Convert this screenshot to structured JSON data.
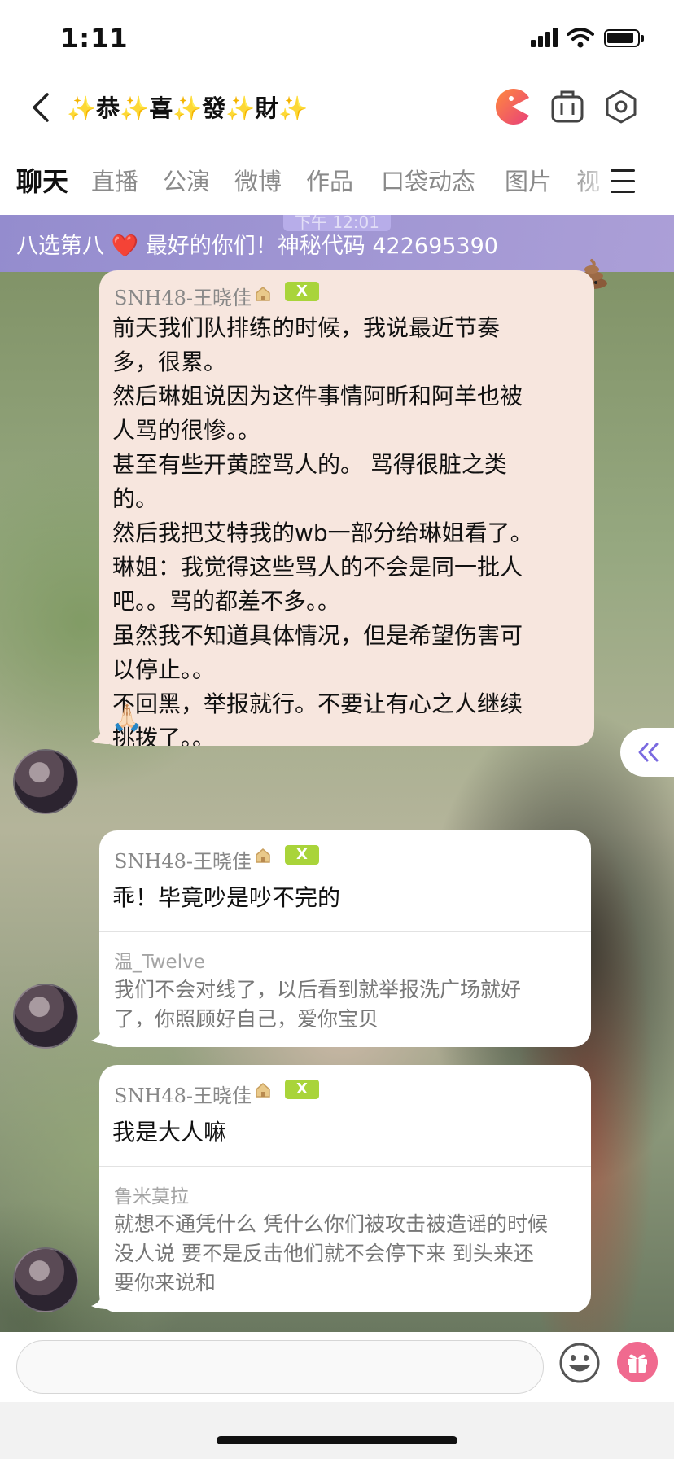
{
  "status_bar": {
    "time": "1:11"
  },
  "header": {
    "title": "✨恭✨喜✨發✨財✨"
  },
  "tabs": [
    "聊天",
    "直播",
    "公演",
    "微博",
    "作品",
    "口袋动态",
    "图片",
    "视"
  ],
  "banner": {
    "text": "八选第八 ❤️ 最好的你们！神秘代码 422695390",
    "ghost_time": "下午 12:01"
  },
  "messages": [
    {
      "sender": "SNH48-王晓佳",
      "badge": "X",
      "lines": [
        "前天我们队排练的时候，我说最近节奏",
        "多，很累。",
        "然后琳姐说因为这件事情阿昕和阿羊也被",
        "人骂的很惨。。",
        "甚至有些开黄腔骂人的。 骂得很脏之类",
        "的。",
        "然后我把艾特我的wb一部分给琳姐看了。",
        "琳姐：我觉得这些骂人的不会是同一批人",
        "吧。。骂的都差不多。。",
        "虽然我不知道具体情况，但是希望伤害可",
        "以停止。。",
        "不回黑，举报就行。不要让有心之人继续",
        "挑拨了。。"
      ],
      "emoji": "🙏🏻"
    },
    {
      "sender": "SNH48-王晓佳",
      "badge": "X",
      "text": "乖！毕竟吵是吵不完的",
      "quote_user": "温_Twelve",
      "quote_lines": [
        "我们不会对线了，以后看到就举报洗广场就好",
        "了，你照顾好自己，爱你宝贝"
      ]
    },
    {
      "sender": "SNH48-王晓佳",
      "badge": "X",
      "text": "我是大人嘛",
      "quote_user": "鲁米莫拉",
      "quote_lines": [
        "就想不通凭什么 凭什么你们被攻击被造谣的时候",
        "没人说  要不是反击他们就不会停下来  到头来还",
        "要你来说和"
      ]
    }
  ],
  "input": {
    "placeholder": ""
  },
  "colors": {
    "banner": "#a898dc",
    "badge": "#a9d43a",
    "gift": "#f06a8f",
    "pink_bubble": "#f7e6de"
  }
}
